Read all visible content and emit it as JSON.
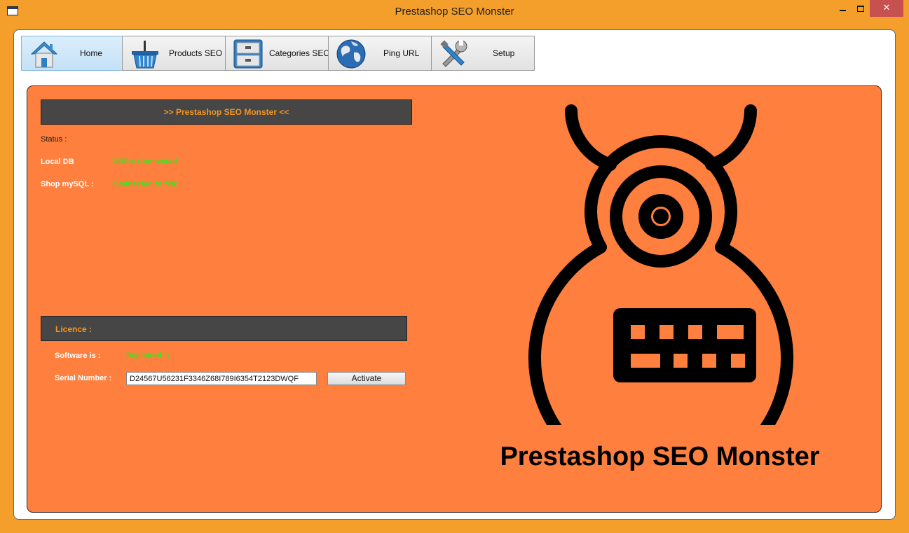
{
  "window": {
    "title": "Prestashop SEO Monster",
    "close_glyph": "✕"
  },
  "tabs": [
    {
      "label": "Home",
      "icon": "home-icon",
      "active": true
    },
    {
      "label": "Products SEO",
      "icon": "basket-icon",
      "active": false
    },
    {
      "label": "Categories SEO",
      "icon": "drawers-icon",
      "active": false
    },
    {
      "label": "Ping URL",
      "icon": "globe-icon",
      "active": false
    },
    {
      "label": "Setup",
      "icon": "tools-icon",
      "active": false
    }
  ],
  "main": {
    "header": ">> Prestashop SEO Monster <<",
    "status_label": "Status :",
    "local_db_label": "Local DB",
    "local_db_value": "DBlite Connected",
    "shop_mysql_label": "Shop mySQL :",
    "shop_mysql_value": "Connected to fxtc"
  },
  "licence": {
    "header": "Licence :",
    "software_label": "Software is :",
    "software_value": "Registred :)",
    "serial_label": "Serial Number :",
    "serial_value": "D24567U56231F3346Z68I789I6354T2123DWQF",
    "activate_label": "Activate"
  },
  "brand": {
    "name": "Prestashop SEO Monster",
    "logo_icon": "monster-logo-icon"
  },
  "colors": {
    "window_frame": "#F49F2C",
    "panel": "#FF7F3F",
    "header_bar": "#464646",
    "header_text": "#F5951F",
    "status_ok": "#33E81A"
  }
}
